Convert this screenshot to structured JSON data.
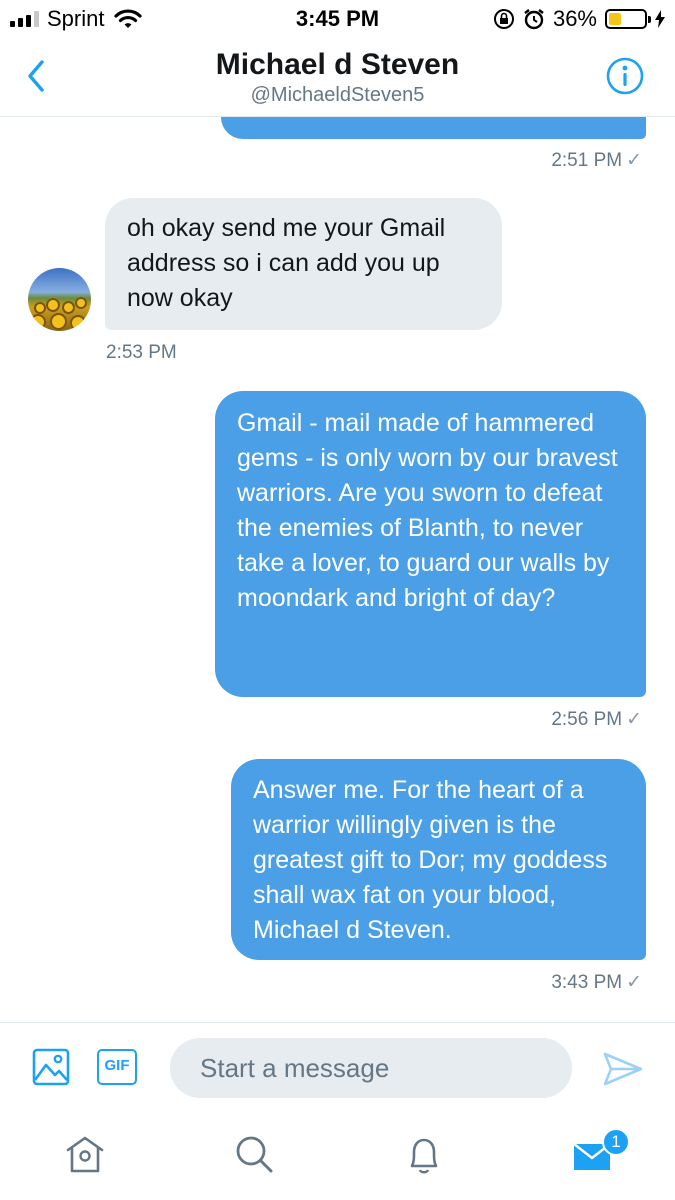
{
  "status_bar": {
    "carrier": "Sprint",
    "time": "3:45 PM",
    "battery_percent": "36%",
    "battery_level": 0.36,
    "icons": [
      "signal-icon",
      "wifi-icon",
      "orientation-lock-icon",
      "alarm-icon",
      "battery-icon",
      "charging-bolt-icon"
    ]
  },
  "header": {
    "title": "Michael d Steven",
    "handle": "@MichaeldSteven5",
    "back_icon": "chevron-left-icon",
    "info_icon": "info-icon"
  },
  "messages": [
    {
      "direction": "outgoing",
      "text": "",
      "time": "2:51 PM",
      "read_check": "✓"
    },
    {
      "direction": "incoming",
      "text": "oh okay send me your Gmail address so i can add you up now okay",
      "time": "2:53 PM"
    },
    {
      "direction": "outgoing",
      "text": "Gmail - mail made of hammered gems - is only worn by our bravest warriors. Are you sworn to defeat the enemies of Blanth, to never take a lover, to guard our walls by moondark and bright of day?",
      "time": "2:56 PM",
      "read_check": "✓"
    },
    {
      "direction": "outgoing",
      "text": "Answer me. For the heart of a warrior willingly given is the greatest gift to Dor; my goddess shall wax fat on your blood, Michael d Steven.",
      "time": "3:43 PM",
      "read_check": "✓"
    }
  ],
  "composer": {
    "placeholder": "Start a message",
    "gif_label": "GIF",
    "icons": [
      "image-icon",
      "gif-icon",
      "send-icon"
    ]
  },
  "tab_bar": {
    "icons": [
      "home-icon",
      "search-icon",
      "notifications-icon",
      "messages-icon"
    ],
    "messages_badge": "1"
  },
  "colors": {
    "accent": "#1da1f2",
    "outgoing_bubble": "#4a9fe6",
    "incoming_bubble": "#e6ecf0",
    "battery": "#f5c518"
  }
}
